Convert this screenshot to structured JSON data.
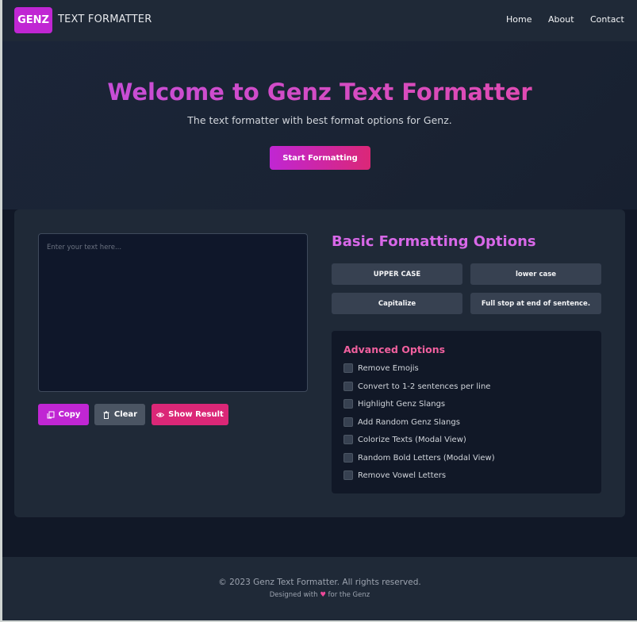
{
  "navbar": {
    "logo_badge": "GENZ",
    "logo_text": "TEXT FORMATTER",
    "links": [
      "Home",
      "About",
      "Contact"
    ]
  },
  "hero": {
    "title": "Welcome to Genz Text Formatter",
    "subtitle": "The text formatter with best format options for Genz.",
    "cta_label": "Start Formatting"
  },
  "editor": {
    "placeholder": "Enter your text here...",
    "buttons": {
      "copy": "Copy",
      "clear": "Clear",
      "show_result": "Show Result"
    }
  },
  "basic": {
    "title": "Basic Formatting Options",
    "buttons": [
      "UPPER CASE",
      "lower case",
      "Capitalize",
      "Full stop at end of sentence."
    ]
  },
  "advanced": {
    "title": "Advanced Options",
    "options": [
      "Remove Emojis",
      "Convert to 1-2 sentences per line",
      "Highlight Genz Slangs",
      "Add Random Genz Slangs",
      "Colorize Texts (Modal View)",
      "Random Bold Letters (Modal View)",
      "Remove Vowel Letters"
    ]
  },
  "footer": {
    "copyright": "© 2023 Genz Text Formatter. All rights reserved.",
    "designed_prefix": "Designed with",
    "heart": "♥",
    "designed_suffix": "for the Genz"
  },
  "colors": {
    "accent_purple": "#c026d3",
    "accent_pink": "#db2777",
    "background": "#111827",
    "panel": "#1f2937"
  }
}
